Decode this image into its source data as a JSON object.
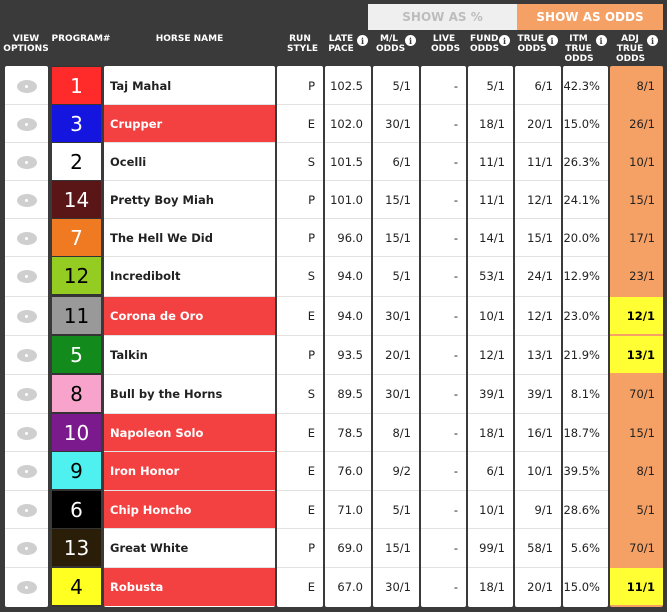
{
  "toggle": {
    "pct_label": "SHOW AS %",
    "odds_label": "SHOW AS ODDS"
  },
  "headers": {
    "view": "VIEW OPTIONS",
    "program": "PROGRAM#",
    "horse": "HORSE NAME",
    "run_style": "RUN STYLE",
    "late_pace": "LATE PACE",
    "ml_odds": "M/L ODDS",
    "live_odds": "LIVE ODDS",
    "fund_odds": "FUND ODDS",
    "true_odds": "TRUE ODDS",
    "itm_true_odds": "ITM TRUE ODDS",
    "adj_true_odds": "ADJ TRUE ODDS"
  },
  "colors": {
    "red_row": "#f34040",
    "adj": "#f5a064",
    "highlight": "#ffff33"
  },
  "rows": [
    {
      "program": "1",
      "pgm_bg": "#ff2a2a",
      "pgm_fg": "#ffffff",
      "horse": "Taj Mahal",
      "red": false,
      "run_style": "P",
      "late_pace": "102.5",
      "ml": "5/1",
      "live": "-",
      "fund": "5/1",
      "true": "6/1",
      "itm": "42.3%",
      "adj": "8/1",
      "hl": false
    },
    {
      "program": "3",
      "pgm_bg": "#1515e0",
      "pgm_fg": "#ffffff",
      "horse": "Crupper",
      "red": true,
      "run_style": "E",
      "late_pace": "102.0",
      "ml": "30/1",
      "live": "-",
      "fund": "18/1",
      "true": "20/1",
      "itm": "15.0%",
      "adj": "26/1",
      "hl": false
    },
    {
      "program": "2",
      "pgm_bg": "#ffffff",
      "pgm_fg": "#000000",
      "horse": "Ocelli",
      "red": false,
      "run_style": "S",
      "late_pace": "101.5",
      "ml": "6/1",
      "live": "-",
      "fund": "11/1",
      "true": "11/1",
      "itm": "26.3%",
      "adj": "10/1",
      "hl": false
    },
    {
      "program": "14",
      "pgm_bg": "#5a1616",
      "pgm_fg": "#ffffff",
      "horse": "Pretty Boy Miah",
      "red": false,
      "run_style": "P",
      "late_pace": "101.0",
      "ml": "15/1",
      "live": "-",
      "fund": "11/1",
      "true": "12/1",
      "itm": "24.1%",
      "adj": "15/1",
      "hl": false
    },
    {
      "program": "7",
      "pgm_bg": "#f07a22",
      "pgm_fg": "#ffffff",
      "horse": "The Hell We Did",
      "red": false,
      "run_style": "P",
      "late_pace": "96.0",
      "ml": "15/1",
      "live": "-",
      "fund": "14/1",
      "true": "15/1",
      "itm": "20.0%",
      "adj": "17/1",
      "hl": false
    },
    {
      "program": "12",
      "pgm_bg": "#95cc22",
      "pgm_fg": "#000000",
      "horse": "Incredibolt",
      "red": false,
      "run_style": "S",
      "late_pace": "94.0",
      "ml": "5/1",
      "live": "-",
      "fund": "53/1",
      "true": "24/1",
      "itm": "12.9%",
      "adj": "23/1",
      "hl": false
    },
    {
      "program": "11",
      "pgm_bg": "#999999",
      "pgm_fg": "#000000",
      "horse": "Corona de Oro",
      "red": true,
      "run_style": "E",
      "late_pace": "94.0",
      "ml": "30/1",
      "live": "-",
      "fund": "10/1",
      "true": "12/1",
      "itm": "23.0%",
      "adj": "12/1",
      "hl": true
    },
    {
      "program": "5",
      "pgm_bg": "#138a1c",
      "pgm_fg": "#ffffff",
      "horse": "Talkin",
      "red": false,
      "run_style": "P",
      "late_pace": "93.5",
      "ml": "20/1",
      "live": "-",
      "fund": "12/1",
      "true": "13/1",
      "itm": "21.9%",
      "adj": "13/1",
      "hl": true
    },
    {
      "program": "8",
      "pgm_bg": "#f7a3cc",
      "pgm_fg": "#000000",
      "horse": "Bull by the Horns",
      "red": false,
      "run_style": "S",
      "late_pace": "89.5",
      "ml": "30/1",
      "live": "-",
      "fund": "39/1",
      "true": "39/1",
      "itm": "8.1%",
      "adj": "70/1",
      "hl": false
    },
    {
      "program": "10",
      "pgm_bg": "#7a1a8c",
      "pgm_fg": "#ffffff",
      "horse": "Napoleon Solo",
      "red": true,
      "run_style": "E",
      "late_pace": "78.5",
      "ml": "8/1",
      "live": "-",
      "fund": "18/1",
      "true": "16/1",
      "itm": "18.7%",
      "adj": "15/1",
      "hl": false
    },
    {
      "program": "9",
      "pgm_bg": "#4ff0f0",
      "pgm_fg": "#000000",
      "horse": "Iron Honor",
      "red": true,
      "run_style": "E",
      "late_pace": "76.0",
      "ml": "9/2",
      "live": "-",
      "fund": "6/1",
      "true": "10/1",
      "itm": "39.5%",
      "adj": "8/1",
      "hl": false
    },
    {
      "program": "6",
      "pgm_bg": "#000000",
      "pgm_fg": "#ffffff",
      "horse": "Chip Honcho",
      "red": true,
      "run_style": "E",
      "late_pace": "71.0",
      "ml": "5/1",
      "live": "-",
      "fund": "10/1",
      "true": "9/1",
      "itm": "28.6%",
      "adj": "5/1",
      "hl": false
    },
    {
      "program": "13",
      "pgm_bg": "#2a1e08",
      "pgm_fg": "#ffffff",
      "horse": "Great White",
      "red": false,
      "run_style": "P",
      "late_pace": "69.0",
      "ml": "15/1",
      "live": "-",
      "fund": "99/1",
      "true": "58/1",
      "itm": "5.6%",
      "adj": "70/1",
      "hl": false
    },
    {
      "program": "4",
      "pgm_bg": "#ffff22",
      "pgm_fg": "#000000",
      "horse": "Robusta",
      "red": true,
      "run_style": "E",
      "late_pace": "67.0",
      "ml": "30/1",
      "live": "-",
      "fund": "18/1",
      "true": "20/1",
      "itm": "15.0%",
      "adj": "11/1",
      "hl": true
    }
  ]
}
